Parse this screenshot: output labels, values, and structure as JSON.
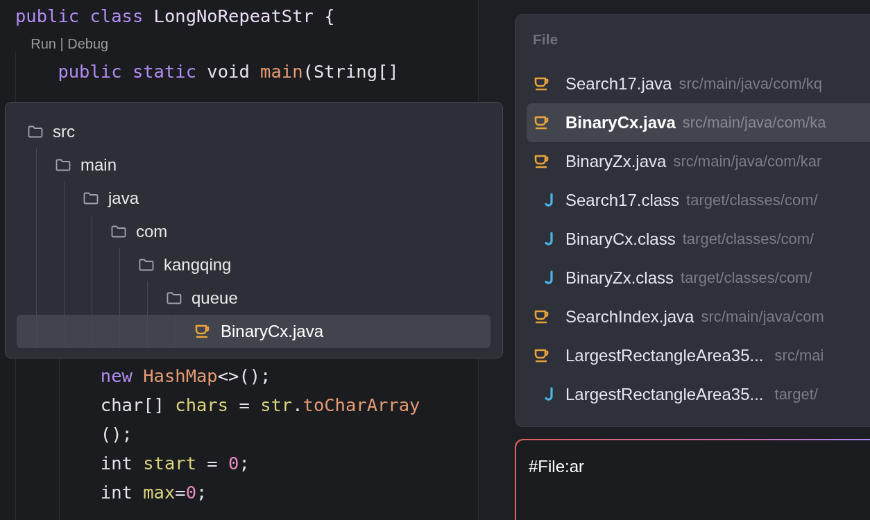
{
  "editor": {
    "lines": [
      {
        "kind": "code",
        "tokens": [
          {
            "text": "public class ",
            "kind": "keyword"
          },
          {
            "text": "LongNoRepeatStr",
            "kind": "class"
          },
          {
            "text": " {",
            "kind": "plain"
          }
        ]
      },
      {
        "kind": "lens",
        "tokens": [
          {
            "text": "    Run | Debug",
            "kind": "lens"
          }
        ]
      },
      {
        "kind": "code",
        "tokens": [
          {
            "text": "    public static ",
            "kind": "keyword"
          },
          {
            "text": "void ",
            "kind": "plain"
          },
          {
            "text": "main",
            "kind": "method"
          },
          {
            "text": "(String[]",
            "kind": "plain"
          }
        ]
      },
      {
        "kind": "gap"
      },
      {
        "kind": "code",
        "tokens": [
          {
            "text": "        new ",
            "kind": "keyword"
          },
          {
            "text": "HashMap",
            "kind": "method"
          },
          {
            "text": "<>();",
            "kind": "plain"
          }
        ]
      },
      {
        "kind": "code",
        "tokens": [
          {
            "text": "        char[] ",
            "kind": "plain"
          },
          {
            "text": "chars",
            "kind": "variable"
          },
          {
            "text": " = ",
            "kind": "plain"
          },
          {
            "text": "str",
            "kind": "variable"
          },
          {
            "text": ".",
            "kind": "plain"
          },
          {
            "text": "toCharArray",
            "kind": "method"
          }
        ]
      },
      {
        "kind": "code",
        "tokens": [
          {
            "text": "        ();",
            "kind": "plain"
          }
        ]
      },
      {
        "kind": "code",
        "tokens": [
          {
            "text": "        int ",
            "kind": "plain"
          },
          {
            "text": "start",
            "kind": "variable"
          },
          {
            "text": " = ",
            "kind": "plain"
          },
          {
            "text": "0",
            "kind": "number"
          },
          {
            "text": ";",
            "kind": "plain"
          }
        ]
      },
      {
        "kind": "code",
        "tokens": [
          {
            "text": "        int ",
            "kind": "plain"
          },
          {
            "text": "max",
            "kind": "variable"
          },
          {
            "text": "=",
            "kind": "plain"
          },
          {
            "text": "0",
            "kind": "number"
          },
          {
            "text": ";",
            "kind": "plain"
          }
        ]
      }
    ]
  },
  "tree_popup": {
    "items": [
      {
        "name": "src",
        "kind": "folder",
        "selected": false,
        "children": [
          {
            "name": "main",
            "kind": "folder",
            "selected": false,
            "children": [
              {
                "name": "java",
                "kind": "folder",
                "selected": false,
                "children": [
                  {
                    "name": "com",
                    "kind": "folder",
                    "selected": false,
                    "children": [
                      {
                        "name": "kangqing",
                        "kind": "folder",
                        "selected": false,
                        "children": [
                          {
                            "name": "queue",
                            "kind": "folder",
                            "selected": false,
                            "children": [
                              {
                                "name": "BinaryCx.java",
                                "kind": "java",
                                "selected": true
                              }
                            ]
                          }
                        ]
                      }
                    ]
                  }
                ]
              }
            ]
          }
        ]
      }
    ]
  },
  "file_picker": {
    "header": "File",
    "items": [
      {
        "name": "Search17.java",
        "path": "src/main/java/com/kq",
        "kind": "java",
        "selected": false
      },
      {
        "name": "BinaryCx.java",
        "path": "src/main/java/com/ka",
        "kind": "java",
        "selected": true
      },
      {
        "name": "BinaryZx.java",
        "path": "src/main/java/com/kar",
        "kind": "java",
        "selected": false
      },
      {
        "name": "Search17.class",
        "path": "target/classes/com/",
        "kind": "class",
        "selected": false
      },
      {
        "name": "BinaryCx.class",
        "path": "target/classes/com/",
        "kind": "class",
        "selected": false
      },
      {
        "name": "BinaryZx.class",
        "path": "target/classes/com/",
        "kind": "class",
        "selected": false
      },
      {
        "name": "SearchIndex.java",
        "path": "src/main/java/com",
        "kind": "java",
        "selected": false
      },
      {
        "name": "LargestRectangleArea35...",
        "path": "src/mai",
        "kind": "java",
        "selected": false
      },
      {
        "name": "LargestRectangleArea35...",
        "path": "target/",
        "kind": "class",
        "selected": false
      }
    ]
  },
  "chat_input": {
    "value": "#File:ar"
  }
}
